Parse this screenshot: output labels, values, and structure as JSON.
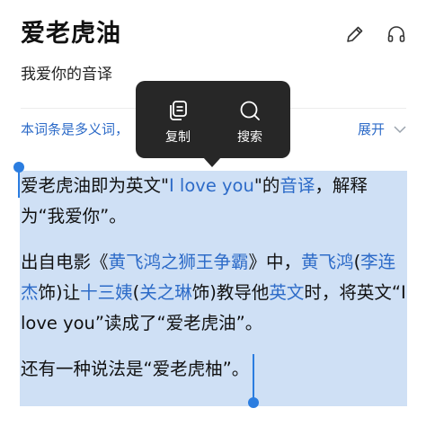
{
  "header": {
    "title": "爱老虎油",
    "edit_icon": "pencil-icon",
    "listen_icon": "headphones-icon"
  },
  "subtitle": "我爱你的音译",
  "note": {
    "text": "本词条是多义词，",
    "expand_label": "展开",
    "expand_icon": "chevron-down-icon"
  },
  "popup": {
    "copy_label": "复制",
    "copy_icon": "copy-icon",
    "search_label": "搜索",
    "search_icon": "search-icon"
  },
  "content": {
    "p1": {
      "t1": "爱老虎油即为英文\"",
      "link1": "I love you",
      "t2": "\"的",
      "link2": "音译",
      "t3": "，解释为“我爱你”。"
    },
    "p2": {
      "t1": "出自电影《",
      "link1": "黄飞鸿之狮王争霸",
      "t2": "》中，",
      "link2": "黄飞鸿",
      "t3": "(",
      "link3": "李连杰",
      "t4": "饰)让",
      "link4": "十三姨",
      "t5": "(",
      "link5": "关之琳",
      "t6": "饰)教导他",
      "link6": "英文",
      "t7": "时，将英文“I love you”读成了“爱老虎油”。"
    },
    "p3": {
      "t1": "还有一种说法是“爱老虎柚”。"
    }
  },
  "colors": {
    "link": "#2d6bc8",
    "selection": "#cfe0f5",
    "handle": "#2b7de0",
    "popup_bg": "#272727"
  }
}
